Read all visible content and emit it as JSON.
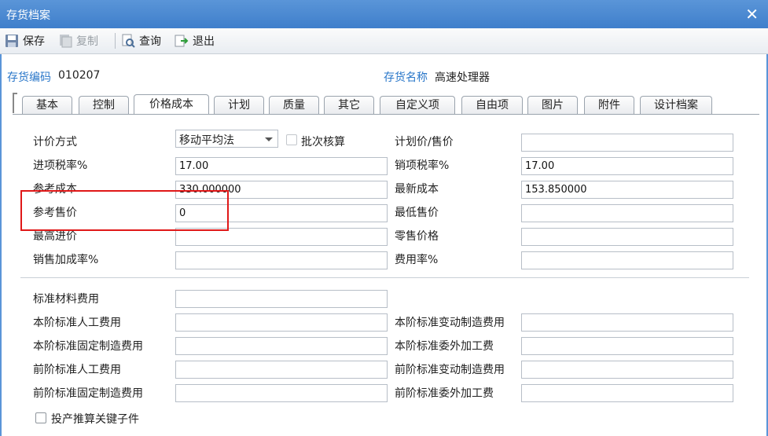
{
  "window": {
    "title": "存货档案"
  },
  "toolbar": {
    "save": "保存",
    "copy": "复制",
    "query": "查询",
    "exit": "退出"
  },
  "header": {
    "code_label": "存货编码",
    "code_value": "010207",
    "name_label": "存货名称",
    "name_value": "高速处理器"
  },
  "tabs": [
    "基本",
    "控制",
    "价格成本",
    "计划",
    "质量",
    "其它",
    "自定义项",
    "自由项",
    "图片",
    "附件",
    "设计档案"
  ],
  "form": {
    "pricing_method_label": "计价方式",
    "pricing_method_value": "移动平均法",
    "batch_label": "批次核算",
    "plan_price_label": "计划价/售价",
    "input_tax_label": "进项税率%",
    "input_tax_value": "17.00",
    "output_tax_label": "销项税率%",
    "output_tax_value": "17.00",
    "ref_cost_label": "参考成本",
    "ref_cost_value": "330.000000",
    "latest_cost_label": "最新成本",
    "latest_cost_value": "153.850000",
    "ref_price_label": "参考售价",
    "ref_price_value": "0",
    "min_price_label": "最低售价",
    "max_purchase_label": "最高进价",
    "retail_price_label": "零售价格",
    "markup_label": "销售加成率%",
    "expense_rate_label": "费用率%",
    "std_material_label": "标准材料费用",
    "std_labor_label": "本阶标准人工费用",
    "std_var_mfg_label": "本阶标准变动制造费用",
    "std_fixed_mfg_label": "本阶标准固定制造费用",
    "std_outsource_label": "本阶标准委外加工费",
    "prev_labor_label": "前阶标准人工费用",
    "prev_var_mfg_label": "前阶标准变动制造费用",
    "prev_fixed_mfg_label": "前阶标准固定制造费用",
    "prev_outsource_label": "前阶标准委外加工费",
    "key_child_label": "投产推算关键子件"
  },
  "colors": {
    "titlebar": "#4a89d2",
    "accent_label": "#2a77c9",
    "highlight": "#e01818"
  }
}
